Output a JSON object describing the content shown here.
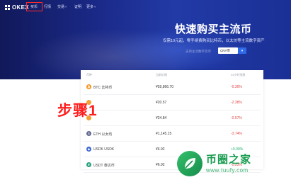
{
  "nav": {
    "logo": "OKEX",
    "items": [
      {
        "label": "买币",
        "dropdown": false
      },
      {
        "label": "行情",
        "dropdown": false
      },
      {
        "label": "交易",
        "dropdown": true
      },
      {
        "label": "证明",
        "dropdown": false
      },
      {
        "label": "更多",
        "dropdown": true
      }
    ],
    "chevron": "˅"
  },
  "hero": {
    "title": "快速购买主流币",
    "subtitle": "仅需10元起，零手续费购买比特币，以太坊等主流数字资产",
    "pair_label": "支持主流数字货币",
    "currency": "CNY币",
    "buy_glyph": "▾"
  },
  "table": {
    "headers": [
      "币种",
      "当前价格",
      "24小时涨跌"
    ],
    "rows": [
      {
        "name": "BTC 比特币",
        "price": "¥59,866.70",
        "change": "-0.36%",
        "coin_color": "#f7931a",
        "coin_glyph": "₿",
        "direction": "down"
      },
      {
        "name": "",
        "price": "¥20.57",
        "change": "-2.38%",
        "coin_color": "#f2a33a",
        "coin_glyph": "",
        "direction": "down"
      },
      {
        "name": "",
        "price": "¥24.84",
        "change": "-0.57%",
        "coin_color": "#f0a330",
        "coin_glyph": "",
        "direction": "down"
      },
      {
        "name": "ETH 以太坊",
        "price": "¥1,145.15",
        "change": "-3.74%",
        "coin_color": "#62688f",
        "coin_glyph": "Ξ",
        "direction": "down"
      },
      {
        "name": "USDK USDK",
        "price": "¥6.92",
        "change": "+0.00%",
        "coin_color": "#3e67d6",
        "coin_glyph": "◆",
        "direction": "up"
      },
      {
        "name": "USDT 泰达币",
        "price": "¥6.92",
        "change": "-0.23%",
        "coin_color": "#26a17b",
        "coin_glyph": "₮",
        "direction": "down"
      }
    ]
  },
  "annotation": {
    "text": "步骤1",
    "color": "#ff1d1d"
  },
  "watermark": {
    "title": "币圈之家",
    "url": "www.tuufy.com"
  },
  "colors": {
    "up": "#19b26b",
    "down": "#e64545",
    "accent": "#2f6ae8"
  }
}
